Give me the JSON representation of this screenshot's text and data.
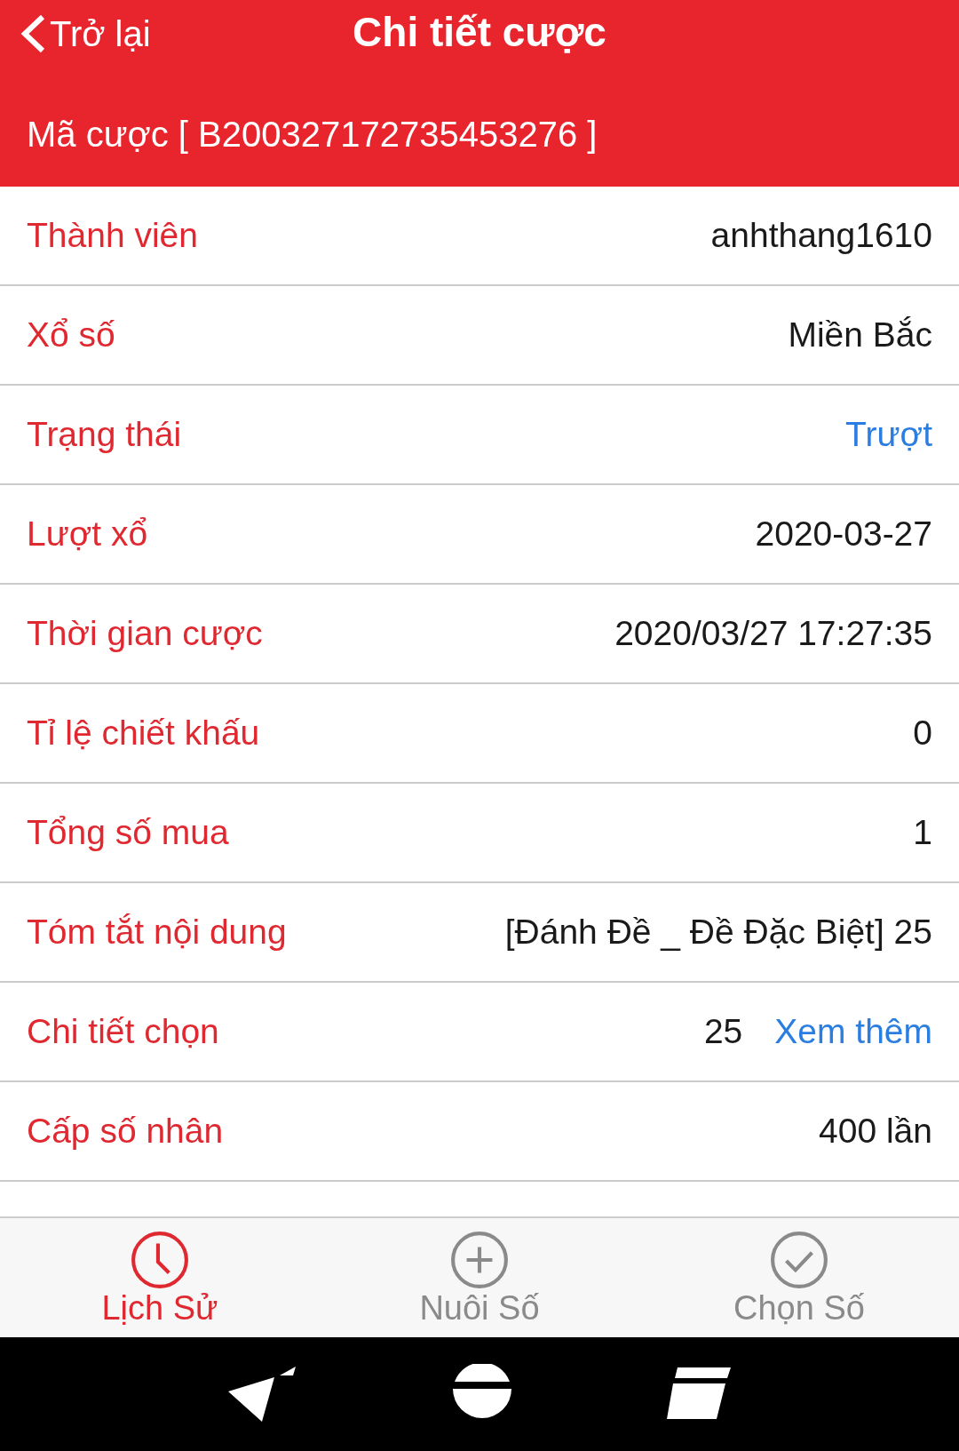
{
  "header": {
    "back_label": "Trở lại",
    "title": "Chi tiết cược",
    "bet_code": "Mã cược [ B200327172735453276 ]"
  },
  "rows": [
    {
      "kind": "plain",
      "label": "Thành viên",
      "value": "anhthang1610"
    },
    {
      "kind": "plain",
      "label": "Xổ số",
      "value": "Miền Bắc"
    },
    {
      "kind": "status",
      "label": "Trạng thái",
      "value": "Trượt"
    },
    {
      "kind": "plain",
      "label": "Lượt xổ",
      "value": "2020-03-27"
    },
    {
      "kind": "plain",
      "label": "Thời gian cược",
      "value": "2020/03/27 17:27:35"
    },
    {
      "kind": "plain",
      "label": "Tỉ lệ chiết khấu",
      "value": "0"
    },
    {
      "kind": "plain",
      "label": "Tổng số mua",
      "value": "1"
    },
    {
      "kind": "plain",
      "label": "Tóm tắt nội dung",
      "value": "[Đánh Đề _ Đề Đặc Biệt] 25"
    },
    {
      "kind": "link",
      "label": "Chi tiết chọn",
      "value": "25",
      "link": "Xem thêm"
    },
    {
      "kind": "plain",
      "label": "Cấp số nhân",
      "value": "400 lần"
    }
  ],
  "tabs": [
    {
      "kind": "history",
      "label": "Lịch Sử",
      "selected": true
    },
    {
      "kind": "add",
      "label": "Nuôi Số",
      "selected": false
    },
    {
      "kind": "pick",
      "label": "Chọn Số",
      "selected": false
    }
  ]
}
